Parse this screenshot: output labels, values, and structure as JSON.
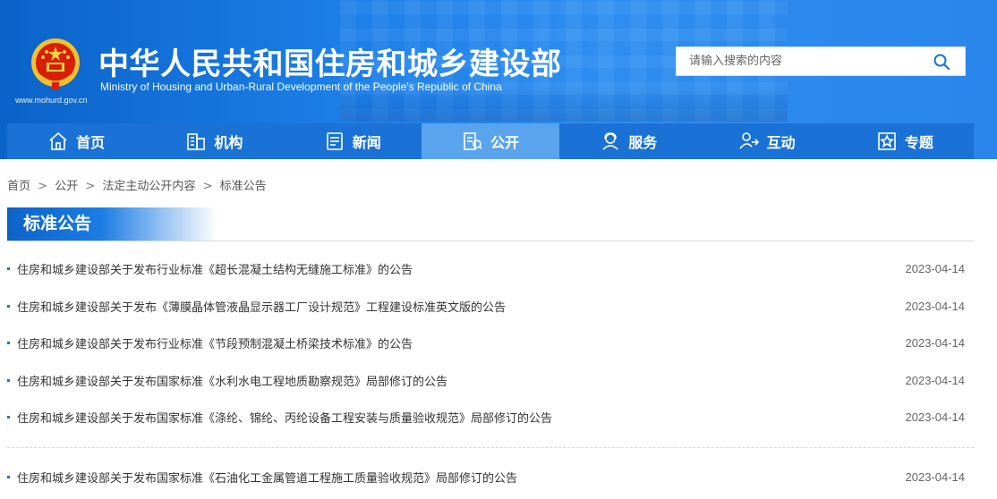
{
  "header": {
    "title_cn": "中华人民共和国住房和城乡建设部",
    "title_en": "Ministry of Housing and Urban-Rural Development of the People’s Republic of China",
    "site_url": "www.mohurd.gov.cn",
    "search_placeholder": "请输入搜索的内容",
    "search_icon": "search-icon"
  },
  "nav": {
    "items": [
      {
        "label": "首页",
        "icon": "home-icon"
      },
      {
        "label": "机构",
        "icon": "building-icon"
      },
      {
        "label": "新闻",
        "icon": "news-icon"
      },
      {
        "label": "公开",
        "icon": "disclosure-icon"
      },
      {
        "label": "服务",
        "icon": "service-icon"
      },
      {
        "label": "互动",
        "icon": "interaction-icon"
      },
      {
        "label": "专题",
        "icon": "star-icon"
      }
    ],
    "active_index": 3,
    "colors": {
      "bar": "#1a72d6",
      "active": "#5aa4ee"
    }
  },
  "breadcrumb": {
    "items": [
      "首页",
      "公开",
      "法定主动公开内容",
      "标准公告"
    ],
    "separator": ">"
  },
  "section": {
    "title": "标准公告"
  },
  "list": {
    "items": [
      {
        "title": "住房和城乡建设部关于发布行业标准《超长混凝土结构无缝施工标准》的公告",
        "date": "2023-04-14"
      },
      {
        "title": "住房和城乡建设部关于发布《薄膜晶体管液晶显示器工厂设计规范》工程建设标准英文版的公告",
        "date": "2023-04-14"
      },
      {
        "title": "住房和城乡建设部关于发布行业标准《节段预制混凝土桥梁技术标准》的公告",
        "date": "2023-04-14"
      },
      {
        "title": "住房和城乡建设部关于发布国家标准《水利水电工程地质勘察规范》局部修订的公告",
        "date": "2023-04-14"
      },
      {
        "title": "住房和城乡建设部关于发布国家标准《涤纶、锦纶、丙纶设备工程安装与质量验收规范》局部修订的公告",
        "date": "2023-04-14"
      },
      {
        "title": "住房和城乡建设部关于发布国家标准《石油化工金属管道工程施工质量验收规范》局部修订的公告",
        "date": "2023-04-14"
      }
    ]
  }
}
